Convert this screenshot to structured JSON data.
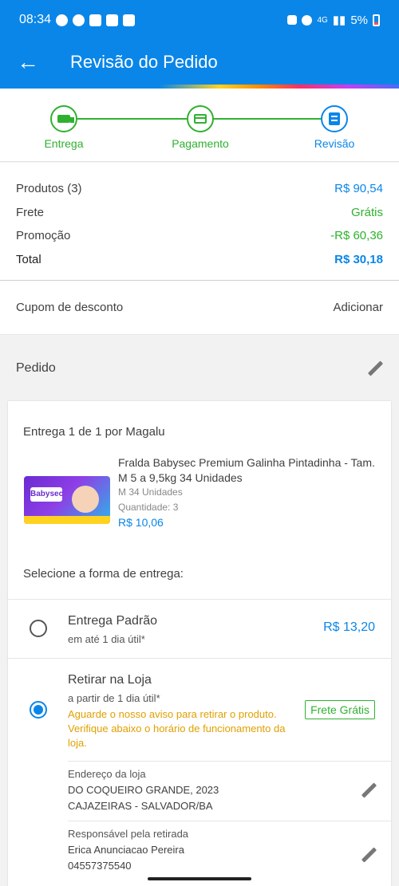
{
  "status_bar": {
    "time": "08:34",
    "battery": "5%",
    "network": "4G"
  },
  "header": {
    "title": "Revisão do Pedido"
  },
  "stepper": {
    "steps": [
      {
        "label": "Entrega",
        "state": "done"
      },
      {
        "label": "Pagamento",
        "state": "done"
      },
      {
        "label": "Revisão",
        "state": "active"
      }
    ]
  },
  "summary": {
    "products_label": "Produtos (3)",
    "products_value": "R$ 90,54",
    "shipping_label": "Frete",
    "shipping_value": "Grátis",
    "promo_label": "Promoção",
    "promo_value": "-R$ 60,36",
    "total_label": "Total",
    "total_value": "R$ 30,18"
  },
  "coupon": {
    "label": "Cupom de desconto",
    "action": "Adicionar"
  },
  "order": {
    "title": "Pedido",
    "delivery_by": "Entrega 1 de 1 por Magalu",
    "product": {
      "brand": "Babysec",
      "name": "Fralda Babysec Premium Galinha Pintadinha - Tam. M 5 a 9,5kg 34 Unidades",
      "variant": "M 34 Unidades",
      "quantity": "Quantidade:  3",
      "price": "R$ 10,06"
    },
    "select_label": "Selecione a forma de entrega:",
    "options": {
      "standard": {
        "title": "Entrega Padrão",
        "subtitle": "em até 1 dia útil*",
        "price": "R$ 13,20",
        "selected": false
      },
      "pickup": {
        "title": "Retirar na Loja",
        "subtitle": "a partir de 1 dia útil*",
        "warning": "Aguarde o nosso aviso para retirar o produto. Verifique abaixo o horário de funcionamento da loja.",
        "badge": "Frete Grátis",
        "selected": true
      }
    },
    "store_address": {
      "label": "Endereço da loja",
      "line1": "DO COQUEIRO GRANDE, 2023",
      "line2": "CAJAZEIRAS - SALVADOR/BA"
    },
    "pickup_person": {
      "label": "Responsável pela retirada",
      "name": "Erica Anunciacao Pereira",
      "doc": "04557375540"
    }
  },
  "colors": {
    "primary": "#0a86e8",
    "success": "#2fb12f",
    "warning": "#e0a000"
  }
}
